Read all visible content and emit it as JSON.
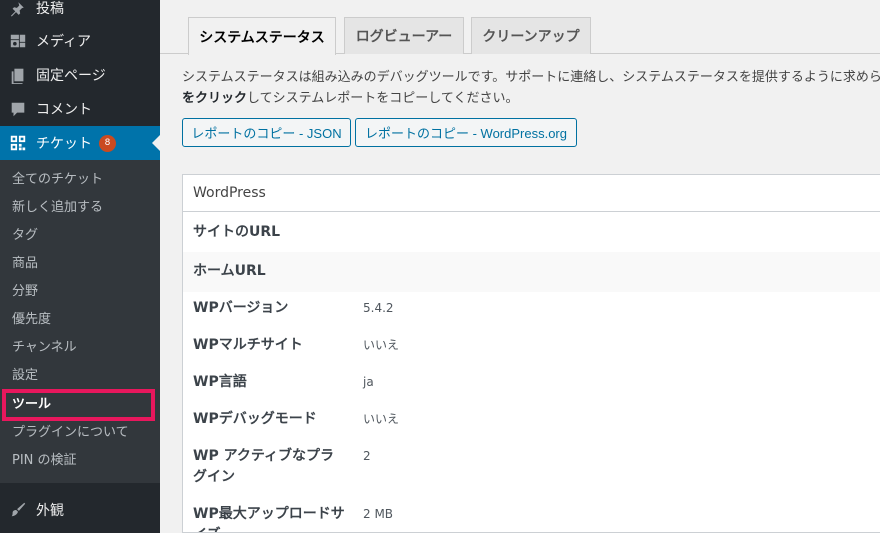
{
  "sidebar": {
    "posts": "投稿",
    "media": "メディア",
    "pages": "固定ページ",
    "comments": "コメント",
    "tickets": "チケット",
    "tickets_badge": "8",
    "appearance": "外観",
    "submenu": [
      "全てのチケット",
      "新しく追加する",
      "タグ",
      "商品",
      "分野",
      "優先度",
      "チャンネル",
      "設定",
      "ツール",
      "プラグインについて",
      "PIN の検証"
    ],
    "current_submenu": "ツール",
    "highlight_color": "#e8175d"
  },
  "tabs": [
    "システムステータス",
    "ログビューアー",
    "クリーンアップ"
  ],
  "active_tab": "システムステータス",
  "description": {
    "line1": "システムステータスは組み込みのデバッグツールです。サポートに連絡し、システムステータスを提供するように求めら",
    "line2_strong": "をクリック",
    "line2_rest": "してシステムレポートをコピーしてください。"
  },
  "buttons": {
    "copy_json": "レポートのコピー - JSON",
    "copy_wporg": "レポートのコピー - WordPress.org"
  },
  "table": {
    "header": "WordPress",
    "rows": [
      {
        "label": "サイトのURL",
        "value": ""
      },
      {
        "label": "ホームURL",
        "value": ""
      },
      {
        "label": "WPバージョン",
        "value": "5.4.2"
      },
      {
        "label": "WPマルチサイト",
        "value": "いいえ"
      },
      {
        "label": "WP言語",
        "value": "ja"
      },
      {
        "label": "WPデバッグモード",
        "value": "いいえ"
      },
      {
        "label": "WP アクティブなプラグイン",
        "value": "2"
      },
      {
        "label": "WP最大アップロードサイズ",
        "value": "2 MB"
      }
    ]
  },
  "colors": {
    "sidebar_bg": "#23282d",
    "active_menu_bg": "#0073aa",
    "badge_bg": "#ca4a1f",
    "button_text": "#0071a1"
  }
}
